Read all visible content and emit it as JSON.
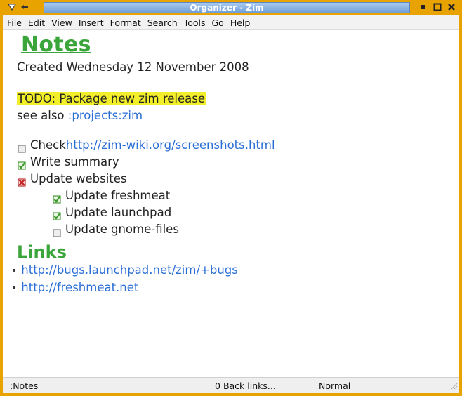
{
  "window": {
    "title": "Organizer - Zim",
    "colors": {
      "frame": "#e8a300",
      "title_strip": "#7fa9dd",
      "heading": "#3aa53a",
      "link": "#2b6fd6",
      "todo_highlight": "#f2ef2a"
    }
  },
  "titlebar": {
    "left_icons": [
      "menu-triangle-icon",
      "shade-icon"
    ],
    "right_icons": [
      "minimize-icon",
      "maximize-icon",
      "close-icon"
    ]
  },
  "menubar": {
    "items": [
      {
        "pre": "",
        "key": "F",
        "post": "ile"
      },
      {
        "pre": "",
        "key": "E",
        "post": "dit"
      },
      {
        "pre": "",
        "key": "V",
        "post": "iew"
      },
      {
        "pre": "",
        "key": "I",
        "post": "nsert"
      },
      {
        "pre": "For",
        "key": "m",
        "post": "at"
      },
      {
        "pre": "",
        "key": "S",
        "post": "earch"
      },
      {
        "pre": "",
        "key": "T",
        "post": "ools"
      },
      {
        "pre": "",
        "key": "G",
        "post": "o"
      },
      {
        "pre": "",
        "key": "H",
        "post": "elp"
      }
    ]
  },
  "page": {
    "title": "Notes",
    "created": "Created Wednesday 12 November 2008",
    "todo": "TODO: Package new zim release",
    "see_also_prefix": "see also ",
    "see_also_link": ":projects:zim",
    "tasks": [
      {
        "state": "unchecked",
        "prefix": "Check ",
        "text": "",
        "link": "http://zim-wiki.org/screenshots.html",
        "indent": 0
      },
      {
        "state": "checked",
        "prefix": "",
        "text": "Write summary",
        "link": "",
        "indent": 0
      },
      {
        "state": "crossed",
        "prefix": "",
        "text": "Update websites",
        "link": "",
        "indent": 0
      },
      {
        "state": "checked",
        "prefix": "",
        "text": "Update freshmeat",
        "link": "",
        "indent": 1
      },
      {
        "state": "checked",
        "prefix": "",
        "text": "Update launchpad",
        "link": "",
        "indent": 1
      },
      {
        "state": "unchecked",
        "prefix": "",
        "text": "Update gnome-files",
        "link": "",
        "indent": 1
      }
    ],
    "links_heading": "Links",
    "links": [
      "http://bugs.launchpad.net/zim/+bugs",
      "http://freshmeat.net"
    ]
  },
  "statusbar": {
    "page": ":Notes",
    "backlinks_count": "0",
    "backlinks_key": "B",
    "backlinks_rest": "ack links...",
    "mode": "Normal"
  }
}
